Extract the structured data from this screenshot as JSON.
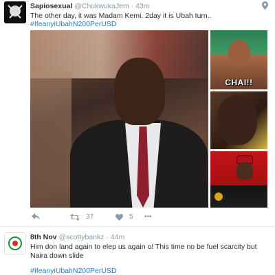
{
  "tweets": [
    {
      "name": "Sapiosexual",
      "handle": "@ChukwukaJem",
      "separator": "·",
      "time": "43m",
      "text": "The other day, it was Madam Kemi. 2day it is Ubah turn..",
      "hashtag": "#IfeanyiUbahN200PerUSD",
      "media_caption": "CHAI!!",
      "actions": {
        "retweets": "37",
        "likes": "5",
        "more": "•••"
      },
      "icons": [
        "avatar",
        "verified-icon",
        "reply-icon",
        "retweet-icon",
        "like-icon",
        "more-icon"
      ]
    },
    {
      "name": "8th Nov",
      "handle": "@scottybankz",
      "separator": "·",
      "time": "44m",
      "text": "Him don land again to elep us again o! This time no be fuel scarcity but Naira down slide",
      "hashtag": "#IfeanyiUbahN200PerUSD"
    }
  ],
  "colors": {
    "link": "#2b7bb9",
    "muted": "#8899a6",
    "text": "#292f33"
  }
}
